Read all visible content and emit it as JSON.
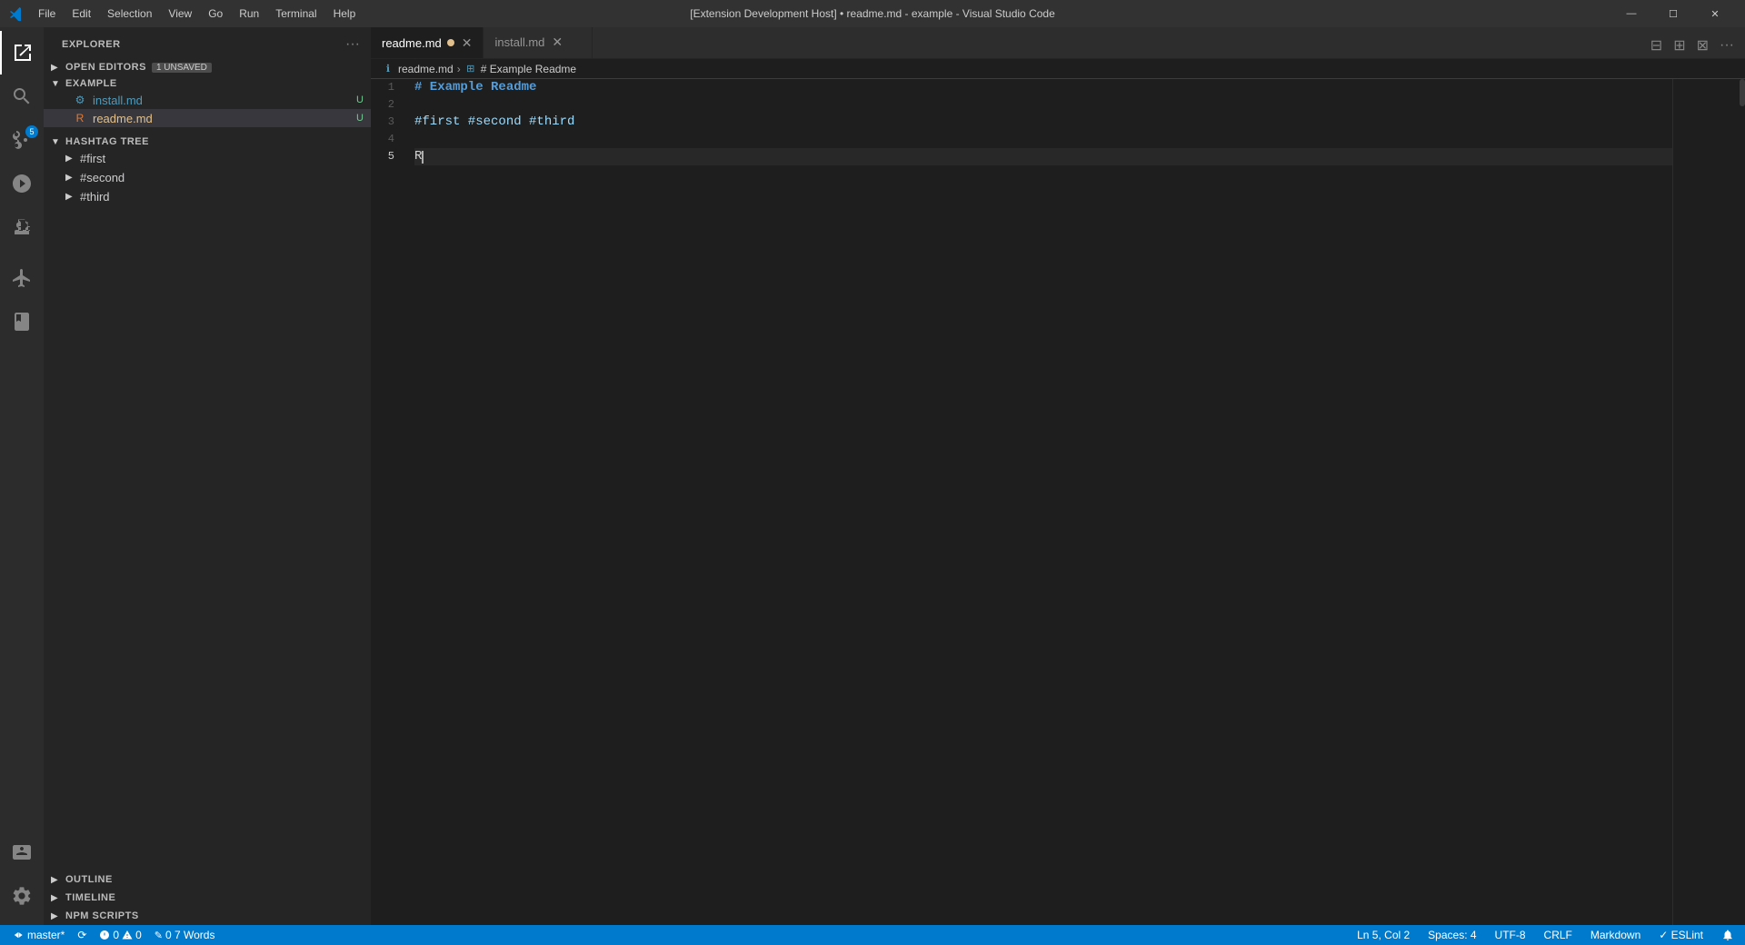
{
  "titleBar": {
    "title": "[Extension Development Host] • readme.md - example - Visual Studio Code",
    "menus": [
      "File",
      "Edit",
      "Selection",
      "View",
      "Go",
      "Run",
      "Terminal",
      "Help"
    ],
    "windowControls": [
      "minimize",
      "maximize",
      "close"
    ]
  },
  "activityBar": {
    "icons": [
      {
        "name": "explorer-icon",
        "label": "Explorer",
        "active": true
      },
      {
        "name": "search-icon",
        "label": "Search"
      },
      {
        "name": "source-control-icon",
        "label": "Source Control",
        "badge": "5"
      },
      {
        "name": "run-icon",
        "label": "Run and Debug"
      },
      {
        "name": "extensions-icon",
        "label": "Extensions"
      },
      {
        "name": "remote-explorer-icon",
        "label": "Remote Explorer"
      },
      {
        "name": "book-icon",
        "label": "Book"
      }
    ],
    "bottomIcons": [
      {
        "name": "account-icon",
        "label": "Account"
      },
      {
        "name": "settings-icon",
        "label": "Settings"
      }
    ]
  },
  "sidebar": {
    "title": "Explorer",
    "openEditors": {
      "label": "Open Editors",
      "badge": "1 UNSAVED",
      "files": [
        {
          "name": "install.md",
          "badge": "U",
          "dirty": false,
          "active": false
        },
        {
          "name": "readme.md",
          "badge": "U",
          "dirty": true,
          "active": true
        }
      ]
    },
    "example": {
      "label": "EXAMPLE",
      "files": [
        {
          "name": "install.md",
          "badge": "U",
          "active": false
        },
        {
          "name": "readme.md",
          "badge": "U",
          "active": true
        }
      ]
    },
    "hashtagTree": {
      "label": "HASHTAG TREE",
      "items": [
        "#first",
        "#second",
        "#third"
      ]
    },
    "outline": {
      "label": "OUTLINE"
    },
    "timeline": {
      "label": "TIMELINE"
    },
    "npmScripts": {
      "label": "NPM SCRIPTS"
    }
  },
  "editor": {
    "tabs": [
      {
        "name": "readme.md",
        "dirty": true,
        "active": true
      },
      {
        "name": "install.md",
        "dirty": false,
        "active": false
      }
    ],
    "breadcrumb": {
      "file": "readme.md",
      "section": "# Example Readme"
    },
    "lines": [
      {
        "num": 1,
        "content": "# Example Readme",
        "type": "heading"
      },
      {
        "num": 2,
        "content": "",
        "type": "empty"
      },
      {
        "num": 3,
        "content": "#first #second #third",
        "type": "hashtags"
      },
      {
        "num": 4,
        "content": "",
        "type": "empty"
      },
      {
        "num": 5,
        "content": "R",
        "type": "cursor",
        "active": true
      }
    ]
  },
  "statusBar": {
    "remote": "master*",
    "sync": "⟳",
    "errors": "0",
    "warnings": "0",
    "words": "0 7 Words",
    "position": "Ln 5, Col 2",
    "spaces": "Spaces: 4",
    "encoding": "UTF-8",
    "lineEnding": "CRLF",
    "language": "Markdown",
    "eslint": "✓ ESLint"
  }
}
